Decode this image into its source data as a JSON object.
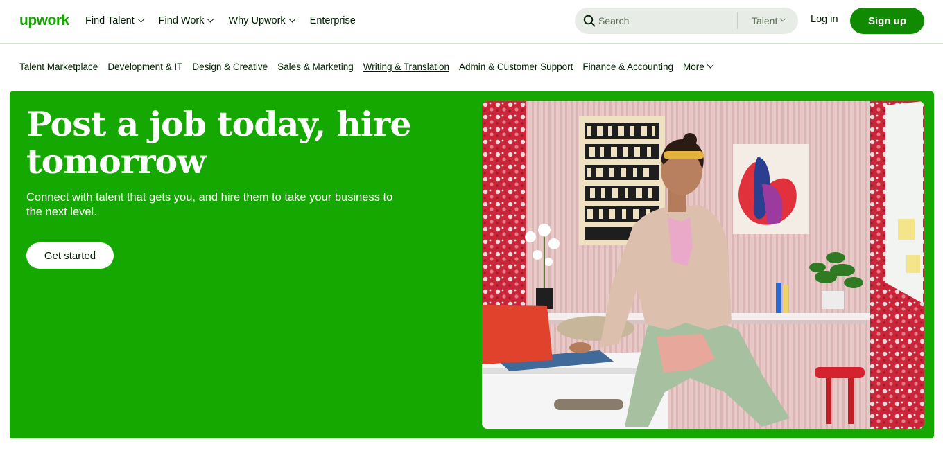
{
  "brand": {
    "logo_text": "upwork",
    "accent": "#14a800",
    "button_green": "#108a00"
  },
  "header": {
    "nav": [
      {
        "label": "Find Talent",
        "has_dropdown": true
      },
      {
        "label": "Find Work",
        "has_dropdown": true
      },
      {
        "label": "Why Upwork",
        "has_dropdown": true
      },
      {
        "label": "Enterprise",
        "has_dropdown": false
      }
    ],
    "search": {
      "placeholder": "Search",
      "type_label": "Talent",
      "icon": "search-icon"
    },
    "login_label": "Log in",
    "signup_label": "Sign up"
  },
  "categories": {
    "items": [
      {
        "label": "Talent Marketplace"
      },
      {
        "label": "Development & IT"
      },
      {
        "label": "Design & Creative"
      },
      {
        "label": "Sales & Marketing"
      },
      {
        "label": "Writing & Translation",
        "active": true
      },
      {
        "label": "Admin & Customer Support"
      },
      {
        "label": "Finance & Accounting"
      }
    ],
    "more_label": "More"
  },
  "hero": {
    "title": "Post a job today, hire tomorrow",
    "subtitle": "Connect with talent that gets you, and hire them to take your business to the next level.",
    "cta_label": "Get started",
    "image_description_icon": "hero-photo"
  }
}
